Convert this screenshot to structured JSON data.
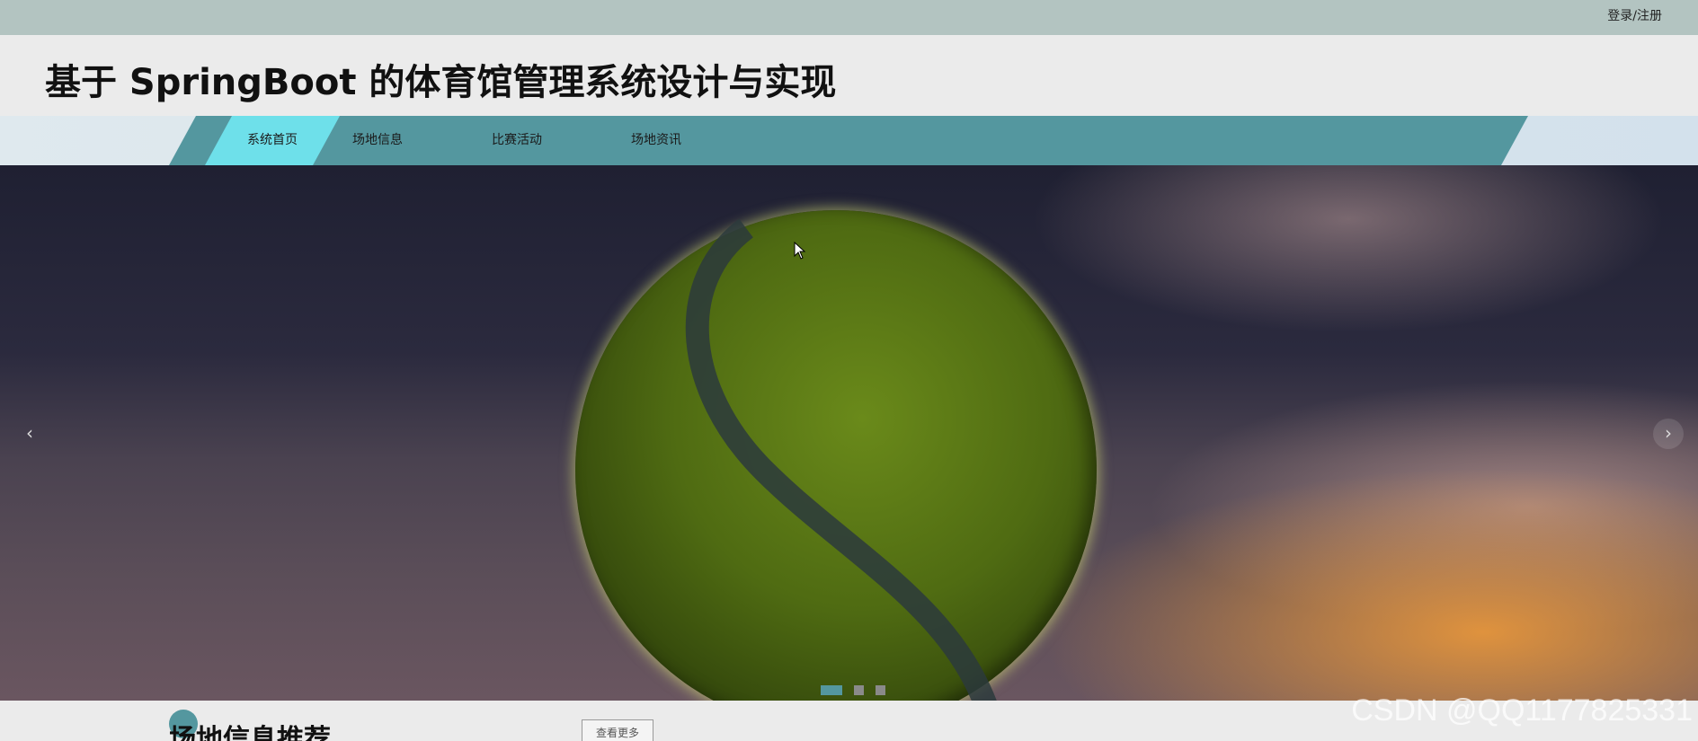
{
  "topbar": {
    "login_label": "登录/注册"
  },
  "header": {
    "title": "基于 SpringBoot 的体育馆管理系统设计与实现"
  },
  "nav": {
    "items": [
      {
        "label": "系统首页",
        "active": true
      },
      {
        "label": "场地信息",
        "active": false
      },
      {
        "label": "比赛活动",
        "active": false
      },
      {
        "label": "场地资讯",
        "active": false
      }
    ]
  },
  "carousel": {
    "prev_icon": "‹",
    "next_icon": "›",
    "slide_count": 3,
    "active_index": 0
  },
  "section": {
    "title": "场地信息推荐",
    "more_label": "查看更多"
  },
  "watermark": "CSDN @QQ1177825331",
  "colors": {
    "accent": "#54979f",
    "nav_active": "#6ee0ea",
    "topbar": "#b3c4c1"
  }
}
